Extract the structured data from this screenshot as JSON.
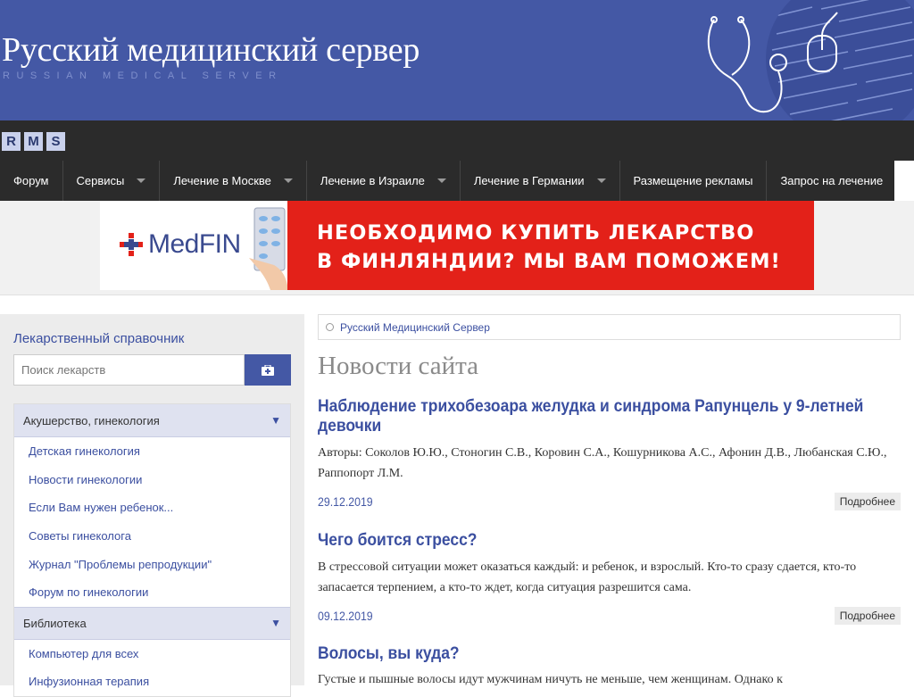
{
  "header": {
    "title": "Русский медицинский сервер",
    "subtitle": "RUSSIAN MEDICAL SERVER"
  },
  "logo": {
    "letters": [
      "R",
      "M",
      "S"
    ]
  },
  "nav": {
    "items": [
      {
        "label": "Форум",
        "dropdown": false
      },
      {
        "label": "Сервисы",
        "dropdown": true
      },
      {
        "label": "Лечение в Москве",
        "dropdown": true
      },
      {
        "label": "Лечение в Израиле",
        "dropdown": true
      },
      {
        "label": "Лечение в Германии",
        "dropdown": true
      },
      {
        "label": "Размещение рекламы",
        "dropdown": false
      },
      {
        "label": "Запрос на лечение",
        "dropdown": false
      }
    ]
  },
  "banner": {
    "brand": "MedFIN",
    "line1": "НЕОБХОДИМО КУПИТЬ ЛЕКАРСТВО",
    "line2": "В ФИНЛЯНДИИ? МЫ ВАМ ПОМОЖЕМ!"
  },
  "sidebar": {
    "title": "Лекарственный справочник",
    "search_placeholder": "Поиск лекарств",
    "categories": [
      {
        "name": "Акушерство, гинекология",
        "items": [
          "Детская гинекология",
          "Новости гинекологии",
          "Если Вам нужен ребенок...",
          "Советы гинеколога",
          "Журнал \"Проблемы репродукции\"",
          "Форум по гинекологии"
        ]
      },
      {
        "name": "Библиотека",
        "items": [
          "Компьютер для всех",
          "Инфузионная терапия"
        ]
      }
    ]
  },
  "breadcrumb": {
    "label": "Русский Медицинский Сервер"
  },
  "main": {
    "title": "Новости сайта",
    "news": [
      {
        "title": "Наблюдение трихобезоара желудка и синдрома Рапунцель у 9-летней девочки",
        "text": "Авторы: Соколов Ю.Ю., Стоногин С.В., Коровин С.А., Кошурникова А.С., Афонин Д.В., Любанская С.Ю., Раппопорт Л.М.",
        "date": "29.12.2019",
        "more": "Подробнее"
      },
      {
        "title": "Чего боится стресс?",
        "text": "В стрессовой ситуации может оказаться каждый: и ребенок, и взрослый. Кто-то сразу сдается, кто-то запасается терпением, а кто-то ждет, когда ситуация разрешится сама.",
        "date": "09.12.2019",
        "more": "Подробнее"
      },
      {
        "title": "Волосы, вы куда?",
        "text": "Густые и пышные волосы идут мужчинам ничуть не меньше, чем женщинам. Однако к",
        "date": "",
        "more": ""
      }
    ]
  },
  "colors": {
    "header_bg": "#4458a5",
    "nav_bg": "#2b2b2b",
    "accent": "#3b4fa0",
    "banner_red": "#e32119"
  }
}
